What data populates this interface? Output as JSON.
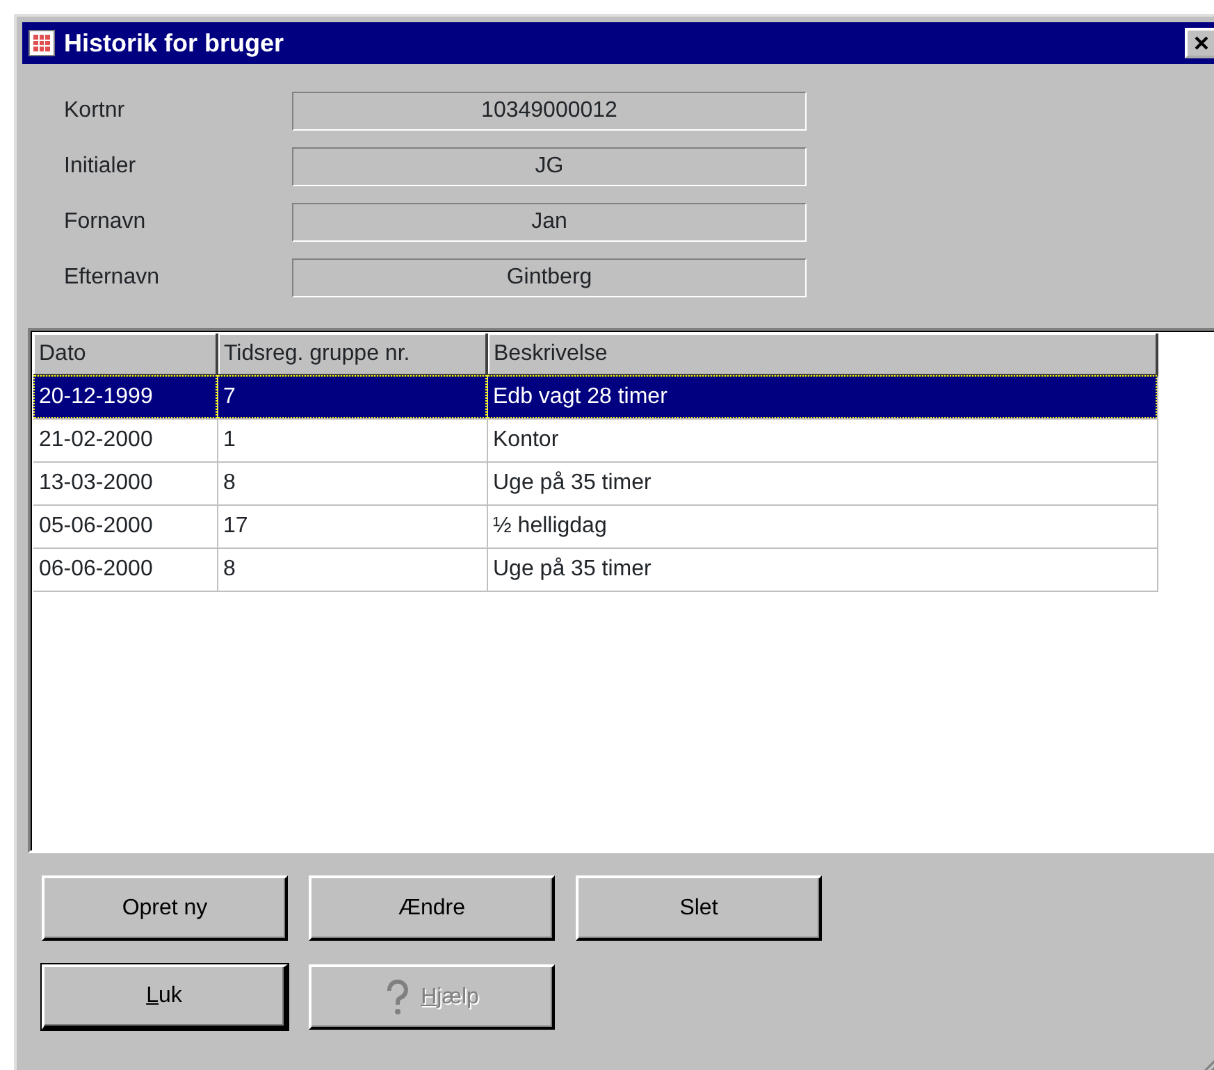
{
  "window": {
    "title": "Historik for bruger"
  },
  "fields": [
    {
      "label": "Kortnr",
      "value": "10349000012"
    },
    {
      "label": "Initialer",
      "value": "JG"
    },
    {
      "label": "Fornavn",
      "value": "Jan"
    },
    {
      "label": "Efternavn",
      "value": "Gintberg"
    }
  ],
  "table": {
    "columns": [
      "Dato",
      "Tidsreg. gruppe nr.",
      "Beskrivelse"
    ],
    "rows": [
      {
        "cells": [
          "20-12-1999",
          "7",
          "Edb vagt 28 timer"
        ],
        "selected": true
      },
      {
        "cells": [
          "21-02-2000",
          "1",
          "Kontor"
        ],
        "selected": false
      },
      {
        "cells": [
          "13-03-2000",
          "8",
          "Uge på 35 timer"
        ],
        "selected": false
      },
      {
        "cells": [
          "05-06-2000",
          "17",
          "½ helligdag"
        ],
        "selected": false
      },
      {
        "cells": [
          "06-06-2000",
          "8",
          "Uge på 35 timer"
        ],
        "selected": false
      }
    ]
  },
  "buttons": [
    [
      {
        "label": "Opret ny",
        "disabled": false,
        "default": false,
        "mnemonic": false
      },
      {
        "label": "Ændre",
        "disabled": false,
        "default": false,
        "mnemonic": false
      },
      {
        "label": "Slet",
        "disabled": false,
        "default": false,
        "mnemonic": false
      }
    ],
    [
      {
        "label": "Luk",
        "disabled": false,
        "default": true,
        "mnemonic": true
      },
      {
        "label": "Hjælp",
        "disabled": true,
        "default": false,
        "mnemonic": true,
        "kind": "help"
      }
    ]
  ]
}
